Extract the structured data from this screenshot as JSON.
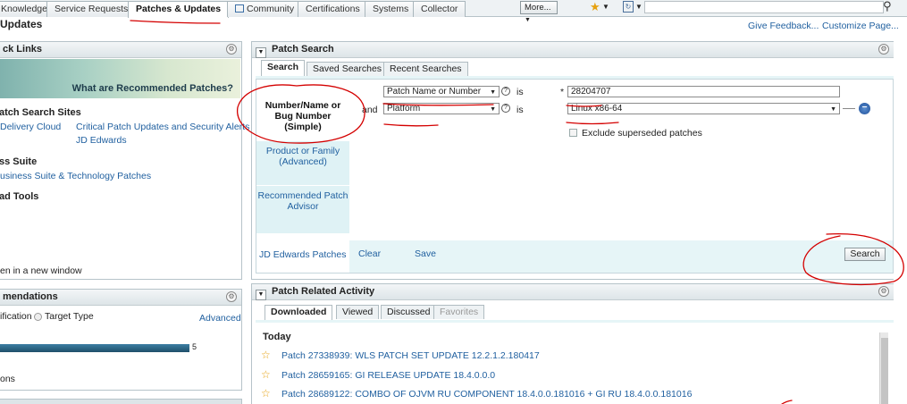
{
  "top_tabs": [
    "Knowledge",
    "Service Requests",
    "Patches & Updates",
    "Community",
    "Certifications",
    "Systems",
    "Collector"
  ],
  "more_label": "More...",
  "page_title": "Updates",
  "header_links": {
    "feedback": "Give Feedback...",
    "customize": "Customize Page..."
  },
  "quick_links": {
    "title": "ck Links",
    "banner_text": "What are Recommended Patches?",
    "patch_sites_title": "atch Search Sites",
    "delivery_cloud": "Delivery Cloud",
    "critical_updates": "Critical Patch Updates and Security Alerts",
    "jd_edwards": "JD Edwards",
    "business_suite_title": "ss Suite",
    "business_suite_link": "usiness Suite & Technology Patches",
    "tools_title": "ad Tools",
    "new_window": "en in a new window"
  },
  "recommendations": {
    "title": "mendations",
    "certification": "ification",
    "target_type": "Target Type",
    "advanced": "Advanced",
    "bar_value": "5",
    "footer": "ons"
  },
  "patch_search": {
    "title": "Patch Search",
    "tabs": [
      "Search",
      "Saved Searches",
      "Recent Searches"
    ],
    "nav": {
      "simple": "Number/Name or Bug Number (Simple)",
      "advanced": "Product or Family (Advanced)",
      "advisor": "Recommended Patch Advisor",
      "jde": "JD Edwards Patches"
    },
    "field1_select": "Patch Name or Number",
    "field1_op": "is",
    "field1_required": "*",
    "field1_value": "28204707",
    "conjunction": "and",
    "field2_select": "Platform",
    "field2_op": "is",
    "field2_value": "Linux x86-64",
    "exclude_label": "Exclude superseded patches",
    "clear": "Clear",
    "save": "Save",
    "search": "Search"
  },
  "activity": {
    "title": "Patch Related Activity",
    "tabs": [
      "Downloaded",
      "Viewed",
      "Discussed",
      "Favorites"
    ],
    "today": "Today",
    "items": [
      "Patch 27338939: WLS PATCH SET UPDATE 12.2.1.2.180417",
      "Patch 28659165: GI RELEASE UPDATE 18.4.0.0.0",
      "Patch 28689122: COMBO OF OJVM RU COMPONENT 18.4.0.0.181016 + GI RU 18.4.0.0.181016"
    ]
  },
  "colors": {
    "link": "#1f5f9f",
    "annotation": "#d40000",
    "star": "#e6a10f"
  }
}
